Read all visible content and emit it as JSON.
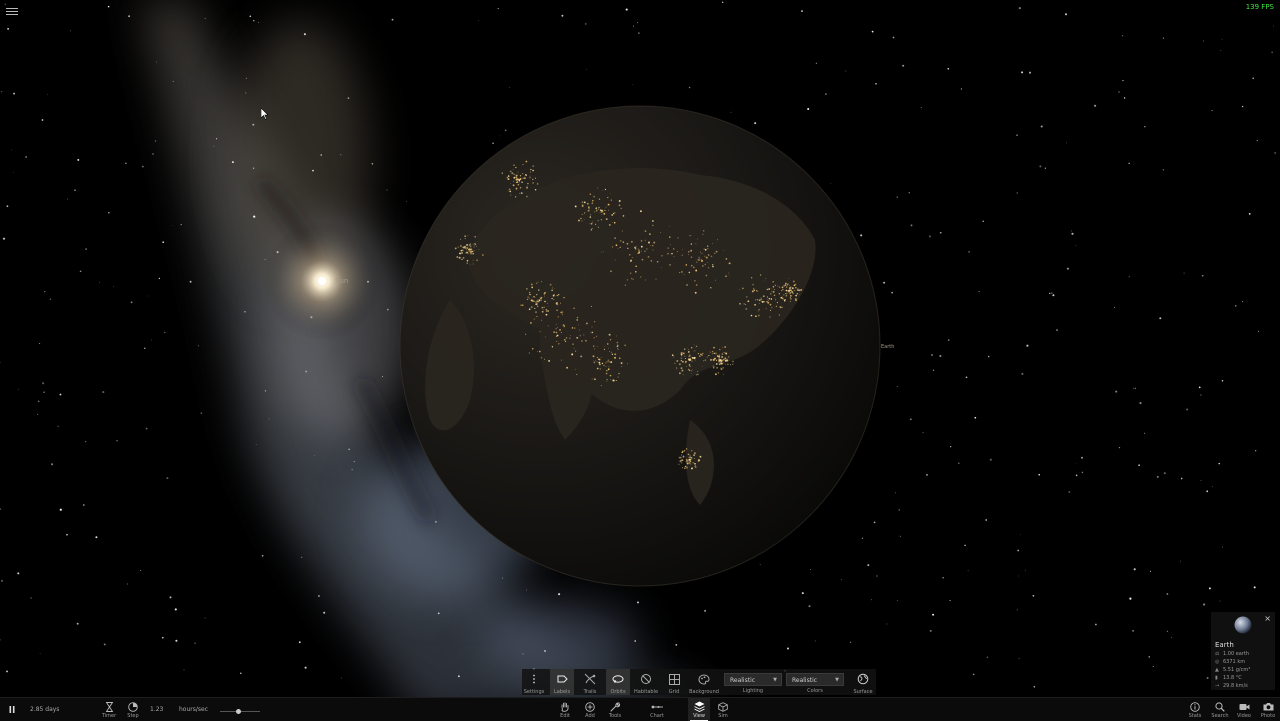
{
  "fps": "139 FPS",
  "labels": {
    "sun": "Sun",
    "earth": "Earth"
  },
  "toolbar": {
    "settings": "Settings",
    "labels": "Labels",
    "trails": "Trails",
    "orbits": "Orbits",
    "habitable": "Habitable",
    "grid": "Grid",
    "background": "Background",
    "lighting_value": "Realistic",
    "lighting_label": "Lighting",
    "colors_value": "Realistic",
    "colors_label": "Colors",
    "surface": "Surface"
  },
  "bottom": {
    "elapsed": "2.85 days",
    "timer": "Timer",
    "step": "Step",
    "rate_value": "1.23",
    "rate_unit": "hours/sec",
    "rate_slider_fraction": 0.45,
    "edit": "Edit",
    "add": "Add",
    "tools": "Tools",
    "chart": "Chart",
    "view": "View",
    "sim": "Sim",
    "stats": "Stats",
    "search": "Search",
    "video": "Video",
    "photo": "Photo"
  },
  "info": {
    "title": "Earth",
    "mass": "1.00 earth",
    "radius": "6371 km",
    "density": "5.51 g/cm³",
    "temperature": "13.8 °C",
    "velocity": "29.8 km/s"
  }
}
